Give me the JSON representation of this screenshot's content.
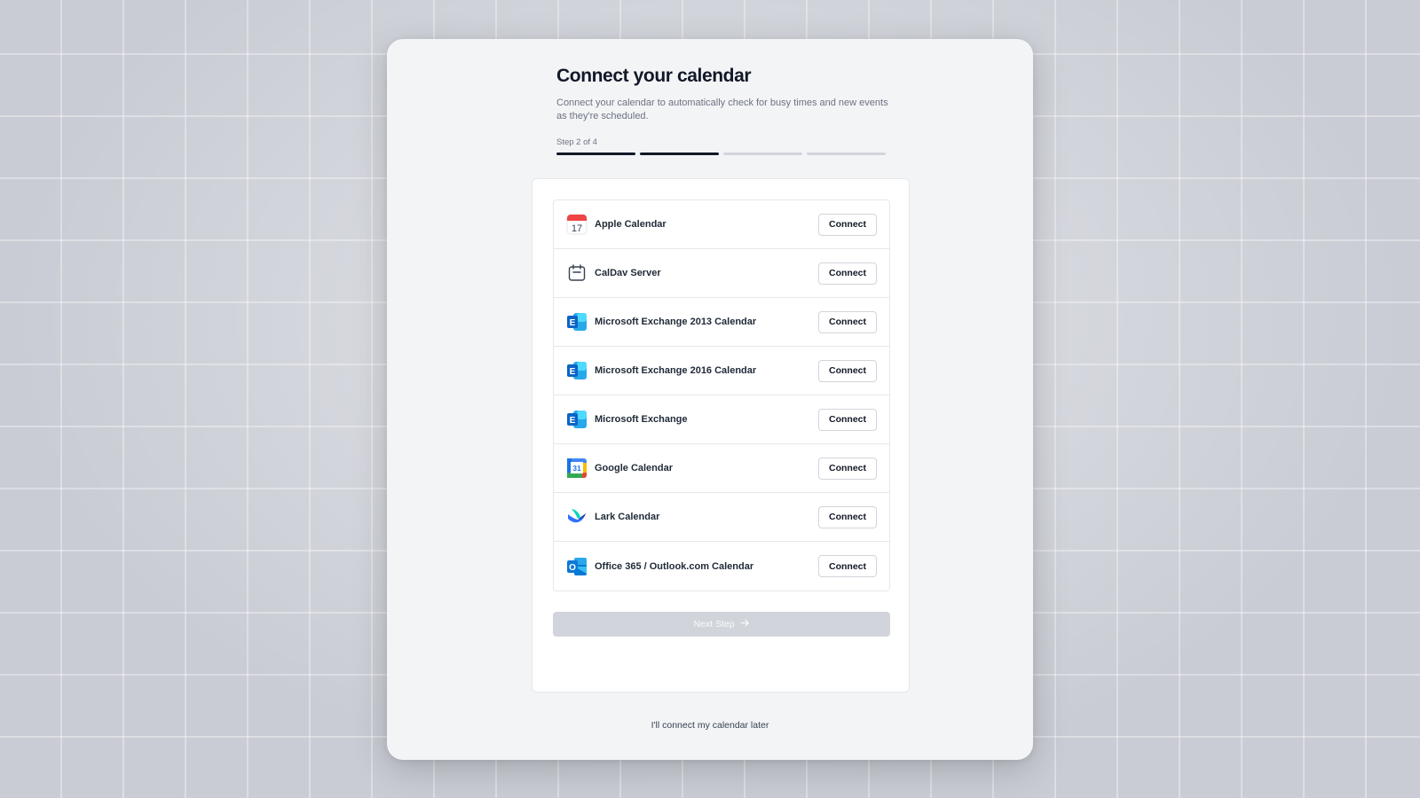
{
  "header": {
    "title": "Connect your calendar",
    "subtitle": "Connect your calendar to automatically check for busy times and new events as they're scheduled.",
    "step_label": "Step 2 of 4",
    "progress": {
      "current": 2,
      "total": 4
    }
  },
  "calendars": [
    {
      "name": "Apple Calendar",
      "icon": "apple-calendar-icon",
      "icon_text": "17",
      "button": "Connect"
    },
    {
      "name": "CalDav Server",
      "icon": "caldav-calendar-icon",
      "button": "Connect"
    },
    {
      "name": "Microsoft Exchange 2013 Calendar",
      "icon": "exchange-icon",
      "icon_text": "E",
      "button": "Connect"
    },
    {
      "name": "Microsoft Exchange 2016 Calendar",
      "icon": "exchange-icon",
      "icon_text": "E",
      "button": "Connect"
    },
    {
      "name": "Microsoft Exchange",
      "icon": "exchange-icon",
      "icon_text": "E",
      "button": "Connect"
    },
    {
      "name": "Google Calendar",
      "icon": "google-calendar-icon",
      "icon_text": "31",
      "button": "Connect"
    },
    {
      "name": "Lark Calendar",
      "icon": "lark-icon",
      "button": "Connect"
    },
    {
      "name": "Office 365 / Outlook.com Calendar",
      "icon": "outlook-icon",
      "icon_text": "O",
      "button": "Connect"
    }
  ],
  "next_button": {
    "label": "Next Step",
    "icon": "arrow-right-icon"
  },
  "skip_link": "I'll connect my calendar later",
  "colors": {
    "primary": "#111827",
    "disabled": "#d1d5db",
    "exchange_blue": "#0a64c5",
    "outlook_blue": "#0f78d4"
  }
}
